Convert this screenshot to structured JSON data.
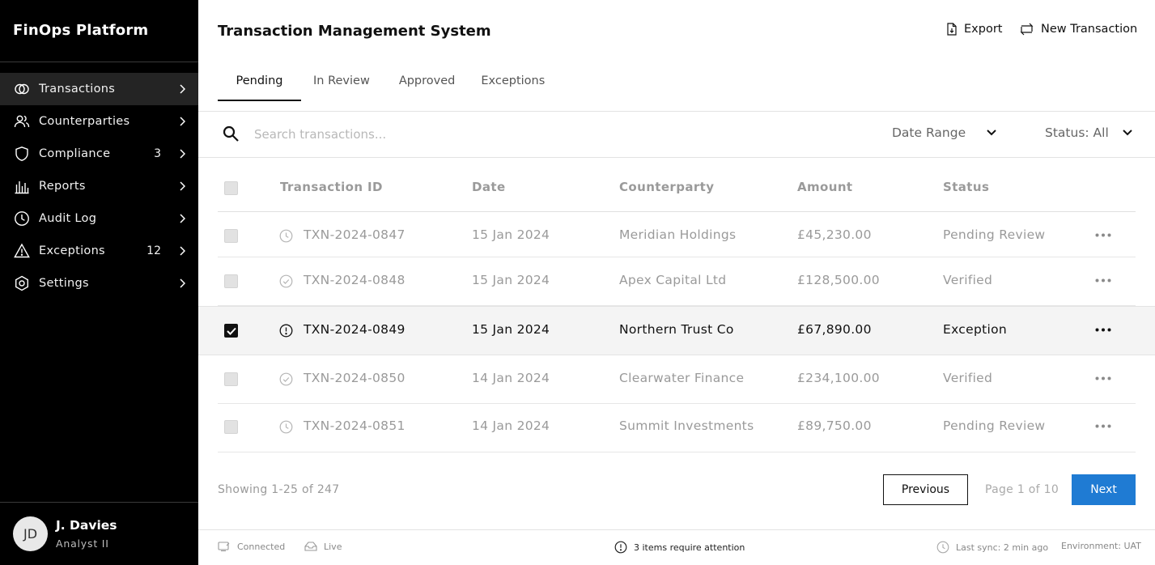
{
  "app": {
    "brand": "FinOps Platform",
    "title": "Transaction Management System"
  },
  "header": {
    "export_label": "Export",
    "new_label": "New Transaction"
  },
  "sidebar": {
    "items": [
      {
        "label": "Transactions",
        "icon": "circles-icon",
        "badge": "",
        "active": true
      },
      {
        "label": "Counterparties",
        "icon": "users-icon",
        "badge": ""
      },
      {
        "label": "Compliance",
        "icon": "shield-icon",
        "badge": "3"
      },
      {
        "label": "Reports",
        "icon": "bar-chart-icon",
        "badge": ""
      },
      {
        "label": "Audit Log",
        "icon": "clock-icon",
        "badge": ""
      },
      {
        "label": "Exceptions",
        "icon": "warning-icon",
        "badge": "12"
      },
      {
        "label": "Settings",
        "icon": "gear-icon",
        "badge": ""
      }
    ]
  },
  "user": {
    "initials": "JD",
    "name": "J. Davies",
    "role": "Analyst II"
  },
  "tabs": [
    "Pending",
    "In Review",
    "Approved",
    "Exceptions"
  ],
  "toolbar": {
    "search_placeholder": "Search transactions...",
    "date_range": "Date Range",
    "status_filter": "Status: All"
  },
  "table": {
    "columns": [
      "Transaction ID",
      "Date",
      "Counterparty",
      "Amount",
      "Status"
    ],
    "rows": [
      {
        "id": "TXN-2024-0847",
        "date": "15 Jan 2024",
        "counterparty": "Meridian Holdings",
        "amount": "£45,230.00",
        "status": "Pending Review",
        "status_icon": "clock-icon",
        "selected": false
      },
      {
        "id": "TXN-2024-0848",
        "date": "15 Jan 2024",
        "counterparty": "Apex Capital Ltd",
        "amount": "£128,500.00",
        "status": "Verified",
        "status_icon": "check-circle-icon",
        "selected": false
      },
      {
        "id": "TXN-2024-0849",
        "date": "15 Jan 2024",
        "counterparty": "Northern Trust Co",
        "amount": "£67,890.00",
        "status": "Exception",
        "status_icon": "alert-circle-icon",
        "selected": true
      },
      {
        "id": "TXN-2024-0850",
        "date": "14 Jan 2024",
        "counterparty": "Clearwater Finance",
        "amount": "£234,100.00",
        "status": "Verified",
        "status_icon": "check-circle-icon",
        "selected": false
      },
      {
        "id": "TXN-2024-0851",
        "date": "14 Jan 2024",
        "counterparty": "Summit Investments",
        "amount": "£89,750.00",
        "status": "Pending Review",
        "status_icon": "clock-icon",
        "selected": false
      }
    ]
  },
  "pagination": {
    "showing": "Showing 1-25 of 247",
    "previous": "Previous",
    "page_info": "Page 1 of 10",
    "next": "Next"
  },
  "statusbar": {
    "connected": "Connected",
    "live": "Live",
    "attention": "3 items require attention",
    "last_sync": "Last sync: 2 min ago",
    "environment": "Environment: UAT"
  },
  "colors": {
    "sidebar_bg": "#000000",
    "accent": "#1f7bd3",
    "muted_text": "#9a9a9a"
  }
}
